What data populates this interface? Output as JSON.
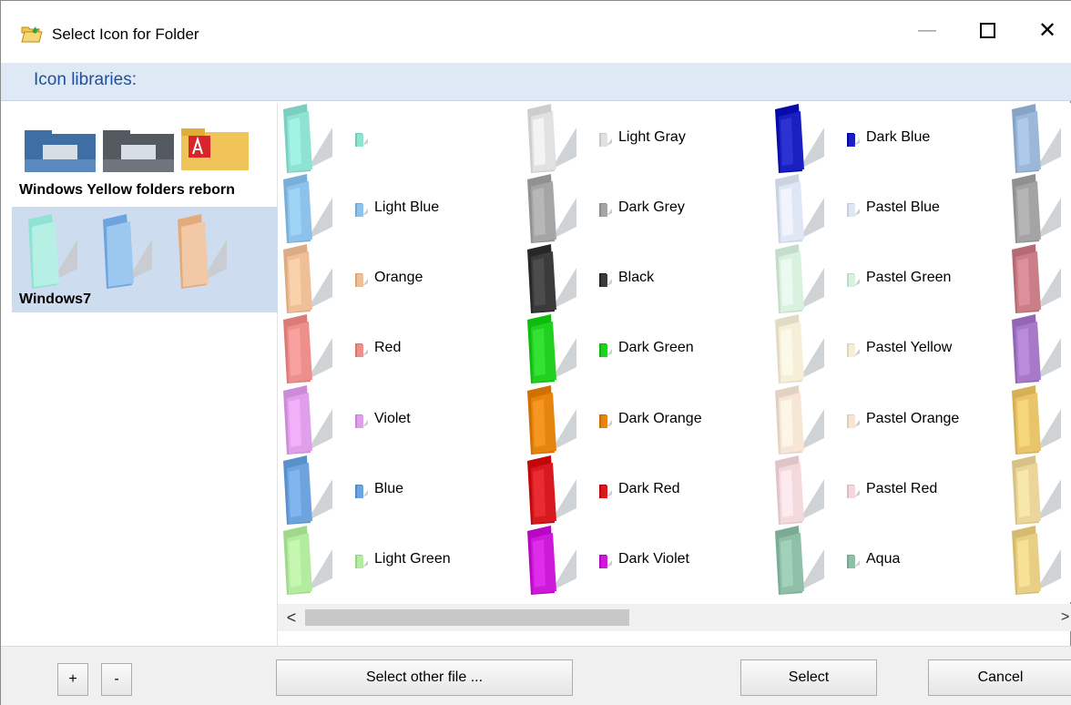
{
  "window": {
    "title": "Select Icon for Folder",
    "minimize_glyph": "—",
    "close_glyph": "✕"
  },
  "libraries": {
    "heading": "Icon libraries:",
    "items": [
      {
        "name": "Windows Yellow folders reborn",
        "selected": false
      },
      {
        "name": "Windows7",
        "selected": true
      }
    ]
  },
  "icons": {
    "columns": [
      [
        {
          "label": "",
          "color": "#8fe3d3"
        },
        {
          "label": "Light Blue",
          "color": "#8dc2ec"
        },
        {
          "label": "Orange",
          "color": "#efbf98"
        },
        {
          "label": "Red",
          "color": "#ee8f8c"
        },
        {
          "label": "Violet",
          "color": "#df9fea"
        },
        {
          "label": "Blue",
          "color": "#6ea4dd"
        },
        {
          "label": "Light Green",
          "color": "#b4ec9f"
        }
      ],
      [
        {
          "label": "Light Gray",
          "color": "#e1e1e1"
        },
        {
          "label": "Dark Grey",
          "color": "#a5a5a5"
        },
        {
          "label": "Black",
          "color": "#3b3b3b"
        },
        {
          "label": "Dark Green",
          "color": "#22d021"
        },
        {
          "label": "Dark Orange",
          "color": "#e5840f"
        },
        {
          "label": "Dark Red",
          "color": "#d71a1f"
        },
        {
          "label": "Dark Violet",
          "color": "#cc1ad8"
        }
      ],
      [
        {
          "label": "Dark Blue",
          "color": "#1a1fbf"
        },
        {
          "label": "Pastel Blue",
          "color": "#dfe6f6"
        },
        {
          "label": "Pastel Green",
          "color": "#d9f1df"
        },
        {
          "label": "Pastel Yellow",
          "color": "#f6efd7"
        },
        {
          "label": "Pastel Orange",
          "color": "#f7e6d6"
        },
        {
          "label": "Pastel Red",
          "color": "#f4d9dc"
        },
        {
          "label": "Aqua",
          "color": "#8fbfa8"
        }
      ],
      [
        {
          "label": "",
          "color": "#9cb8d8"
        },
        {
          "label": "",
          "color": "#a4a4a4"
        },
        {
          "label": "",
          "color": "#c97e88"
        },
        {
          "label": "",
          "color": "#a67ac8"
        },
        {
          "label": "",
          "color": "#e9c46a"
        },
        {
          "label": "",
          "color": "#ecd59a"
        },
        {
          "label": "",
          "color": "#e8cf84"
        }
      ]
    ]
  },
  "scrollbar": {
    "left_arrow": "<",
    "right_arrow": ">",
    "position": 0.0
  },
  "footer": {
    "add_label": "+",
    "remove_label": "-",
    "other_file_label": "Select other file ...",
    "select_label": "Select",
    "cancel_label": "Cancel"
  }
}
